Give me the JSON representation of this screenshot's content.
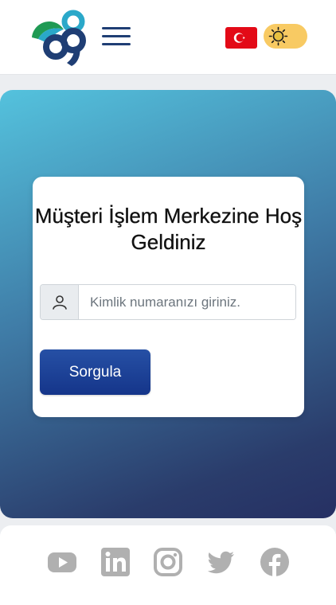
{
  "header": {
    "logo_icon": "company-logo",
    "menu_icon": "hamburger-menu-icon",
    "language_flag": "turkey-flag-icon",
    "theme_toggle_icon": "sun-icon",
    "colors": {
      "flag_red": "#e30a17",
      "toggle_bg": "#f8ca63",
      "menu": "#1f3e74"
    }
  },
  "main": {
    "title": "Müşteri İşlem Merkezine Hoş Geldiniz",
    "id_input": {
      "placeholder": "Kimlik numaranızı giriniz.",
      "value": "",
      "icon": "user-icon"
    },
    "submit_label": "Sorgula",
    "colors": {
      "gradient_start": "#54c2dd",
      "gradient_end": "#263063",
      "button": "#1b3f92"
    }
  },
  "footer": {
    "social_icons": [
      "youtube-icon",
      "linkedin-icon",
      "instagram-icon",
      "twitter-icon",
      "facebook-icon"
    ],
    "icon_color": "#b0b0b0"
  }
}
